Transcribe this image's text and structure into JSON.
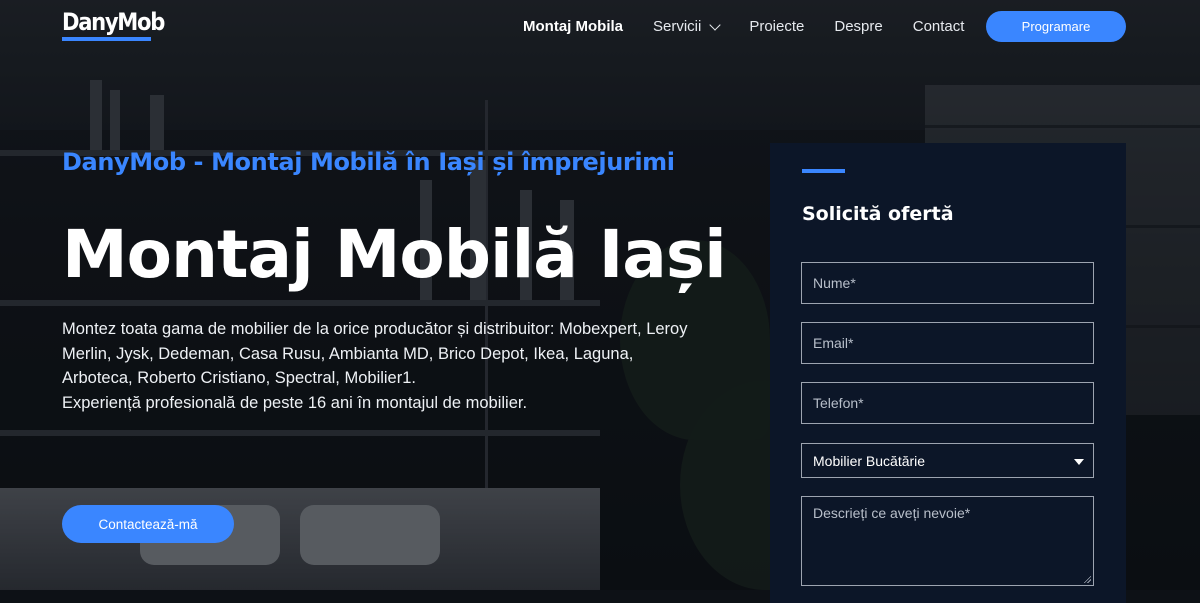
{
  "brand": {
    "logo": "DanyMob",
    "accent": "#3a86ff"
  },
  "nav": {
    "items": [
      {
        "label": "Montaj Mobila",
        "active": true
      },
      {
        "label": "Servicii",
        "dropdown": true
      },
      {
        "label": "Proiecte"
      },
      {
        "label": "Despre"
      },
      {
        "label": "Contact"
      }
    ],
    "cta": "Programare"
  },
  "hero": {
    "subtitle": "DanyMob - Montaj Mobilă în Iași și împrejurimi",
    "title": "Montaj Mobilă Iași",
    "description_line1": "Montez toata gama de mobilier de la orice producător și distribuitor: Mobexpert, Leroy Merlin,  Jysk, Dedeman, Casa Rusu, Ambianta MD, Brico Depot, Ikea, Laguna, Arboteca,  Roberto Cristiano, Spectral, Mobilier1.",
    "description_line2": "Experiență profesională de peste 16 ani în montajul de mobilier.",
    "cta": "Contactează-mă"
  },
  "form": {
    "title": "Solicită ofertă",
    "name_placeholder": "Nume*",
    "email_placeholder": "Email*",
    "phone_placeholder": "Telefon*",
    "service_selected": "Mobilier Bucătărie",
    "message_placeholder": "Descrieți ce aveți nevoie*"
  }
}
